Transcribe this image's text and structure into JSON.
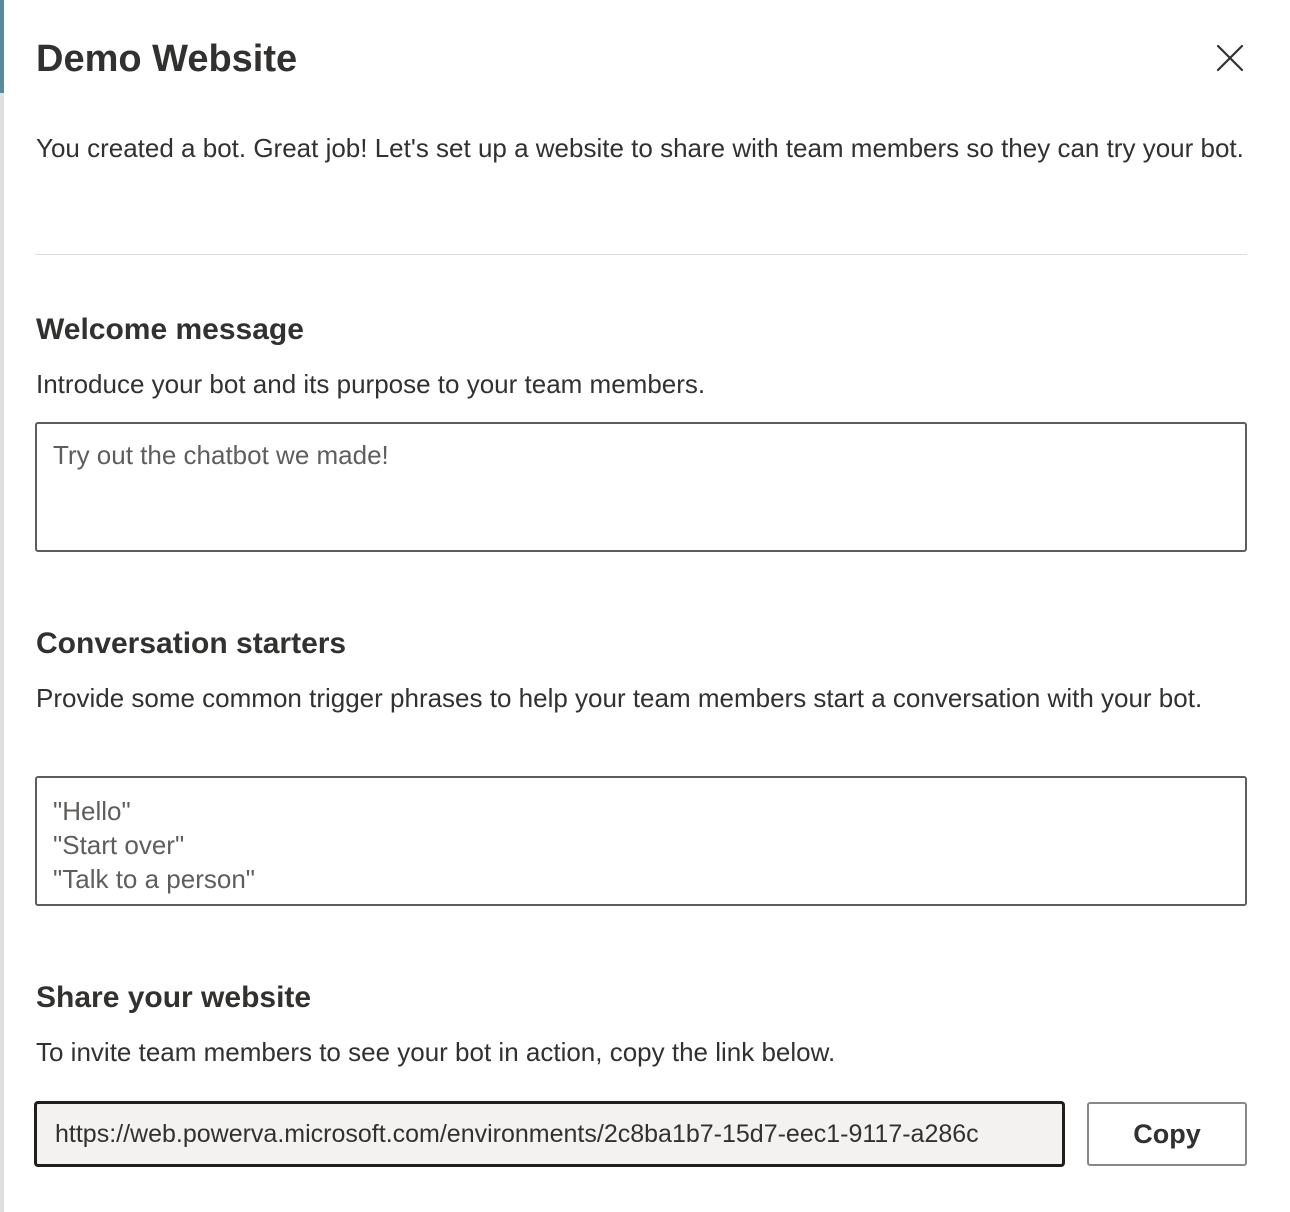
{
  "dialog": {
    "title": "Demo Website",
    "close_icon": "close-icon",
    "intro": "You created a bot. Great job! Let's set up a website to share with team members so they can try your bot."
  },
  "welcome": {
    "heading": "Welcome message",
    "description": "Introduce your bot and its purpose to your team members.",
    "placeholder": "Try out the chatbot we made!"
  },
  "starters": {
    "heading": "Conversation starters",
    "description": "Provide some common trigger phrases to help your team members start a conversation with your bot.",
    "placeholder": "\"Hello\"\n\"Start over\"\n\"Talk to a person\""
  },
  "share": {
    "heading": "Share your website",
    "description": "To invite team members to see your bot in action, copy the link below.",
    "url": "https://web.powerva.microsoft.com/environments/2c8ba1b7-15d7-eec1-9117-a286c",
    "copy_label": "Copy"
  }
}
